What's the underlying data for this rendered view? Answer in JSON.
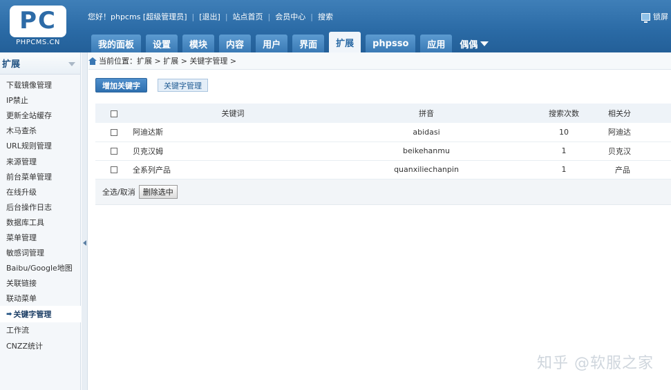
{
  "logo": {
    "mark": "PC",
    "text": "PHPCMS.CN"
  },
  "topbar": {
    "greeting": "您好！phpcms [超级管理员]",
    "links": [
      "[退出]",
      "站点首页",
      "会员中心",
      "搜索"
    ],
    "lock_label": "锁屏"
  },
  "nav": {
    "tabs": [
      "我的面板",
      "设置",
      "模块",
      "内容",
      "用户",
      "界面",
      "扩展",
      "phpsso",
      "应用"
    ],
    "active_tab": "扩展",
    "dropdown_label": "偶偶"
  },
  "sidebar": {
    "title": "扩展",
    "items": [
      "下载镜像管理",
      "IP禁止",
      "更新全站缓存",
      "木马查杀",
      "URL规则管理",
      "来源管理",
      "前台菜单管理",
      "在线升级",
      "后台操作日志",
      "数据库工具",
      "菜单管理",
      "敏感词管理",
      "Baibu/Google地图",
      "关联链接",
      "联动菜单",
      "关键字管理",
      "工作流",
      "CNZZ统计"
    ],
    "active_item": "关键字管理",
    "active_marker": "➡"
  },
  "breadcrumb": "当前位置：扩展 > 扩展 > 关键字管理 >",
  "toolbar": {
    "add_label": "增加关键字",
    "manage_label": "关键字管理"
  },
  "table": {
    "headers": {
      "keyword": "关键词",
      "pinyin": "拼音",
      "count": "搜索次数",
      "related": "相关分"
    },
    "rows": [
      {
        "keyword": "阿迪达斯",
        "pinyin": "abidasi",
        "count": "10",
        "related": "阿迪达"
      },
      {
        "keyword": "贝克汉姆",
        "pinyin": "beikehanmu",
        "count": "1",
        "related": "贝克汉"
      },
      {
        "keyword": "全系列产品",
        "pinyin": "quanxiliechanpin",
        "count": "1",
        "related": "产品"
      }
    ]
  },
  "footer": {
    "select_all_label": "全选/取消",
    "delete_label": "删除选中"
  },
  "watermark": "知乎 @软服之家",
  "colors": {
    "header_blue": "#2a6aa5",
    "active_tab_bg": "#f0f5fa",
    "primary_button": "#2e6faf"
  }
}
